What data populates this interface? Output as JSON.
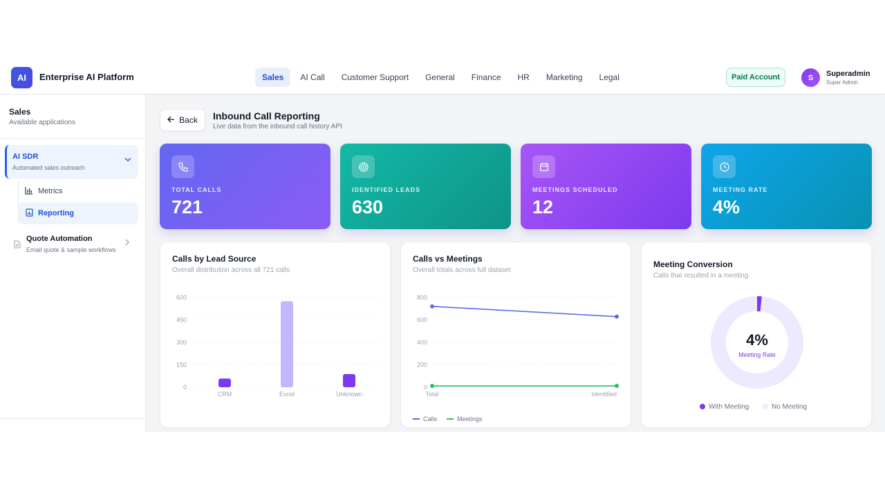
{
  "header": {
    "logo": "AI",
    "brand": "Enterprise AI Platform",
    "nav": [
      "Sales",
      "AI Call",
      "Customer Support",
      "General",
      "Finance",
      "HR",
      "Marketing",
      "Legal"
    ],
    "active_nav": "Sales",
    "paid_badge": "Paid Account",
    "user": {
      "initial": "S",
      "name": "Superadmin",
      "role": "Super Admin"
    }
  },
  "sidebar": {
    "title": "Sales",
    "subtitle": "Available applications",
    "apps": [
      {
        "name": "AI SDR",
        "desc": "Automated sales outreach",
        "expanded": true,
        "children": [
          {
            "label": "Metrics",
            "icon": "bar-chart-icon"
          },
          {
            "label": "Reporting",
            "icon": "report-icon",
            "active": true
          }
        ]
      },
      {
        "name": "Quote Automation",
        "desc": "Email quote & sample workflows",
        "expanded": false
      }
    ]
  },
  "page": {
    "back_label": "Back",
    "title": "Inbound Call Reporting",
    "subtitle": "Live data from the inbound call history API"
  },
  "kpis": [
    {
      "label": "TOTAL CALLS",
      "value": "721",
      "icon": "phone-icon",
      "color_from": "#6366f1",
      "color_to": "#8b5cf6"
    },
    {
      "label": "IDENTIFIED LEADS",
      "value": "630",
      "icon": "target-icon",
      "color_from": "#14b8a6",
      "color_to": "#0d9488"
    },
    {
      "label": "MEETINGS SCHEDULED",
      "value": "12",
      "icon": "calendar-icon",
      "color_from": "#a855f7",
      "color_to": "#7c3aed"
    },
    {
      "label": "MEETING RATE",
      "value": "4%",
      "icon": "clock-icon",
      "color_from": "#0ea5e9",
      "color_to": "#0891b2"
    }
  ],
  "cards": {
    "lead_source": {
      "title": "Calls by Lead Source",
      "subtitle": "Overall distribution across all 721 calls"
    },
    "calls_meetings": {
      "title": "Calls vs Meetings",
      "subtitle": "Overall totals across full dataset"
    },
    "conversion": {
      "title": "Meeting Conversion",
      "subtitle": "Calls that resulted in a meeting",
      "center_value": "4%",
      "center_label": "Meeting Rate"
    }
  },
  "chart_data": [
    {
      "type": "bar",
      "title": "Calls by Lead Source",
      "categories": [
        "CRM",
        "Excel",
        "Unknown"
      ],
      "values": [
        58,
        575,
        88
      ],
      "colors": [
        "#7c3aed",
        "#c4b5fd",
        "#7c3aed"
      ],
      "yticks": [
        0,
        150,
        300,
        450,
        600
      ],
      "ylim": [
        0,
        600
      ],
      "grid": true
    },
    {
      "type": "line",
      "title": "Calls vs Meetings",
      "categories": [
        "Total",
        "Identified"
      ],
      "series": [
        {
          "name": "Calls",
          "values": [
            721,
            630
          ],
          "color": "#5b6ee1"
        },
        {
          "name": "Meetings",
          "values": [
            12,
            12
          ],
          "color": "#22c55e"
        }
      ],
      "yticks": [
        0,
        200,
        400,
        600,
        800
      ],
      "ylim": [
        0,
        800
      ],
      "legend": "bottom-left",
      "grid": true
    },
    {
      "type": "pie",
      "title": "Meeting Conversion",
      "labels": [
        "With Meeting",
        "No Meeting"
      ],
      "values": [
        12,
        709
      ],
      "colors": [
        "#7c3aed",
        "#ede9fe"
      ],
      "legend": "bottom"
    }
  ]
}
